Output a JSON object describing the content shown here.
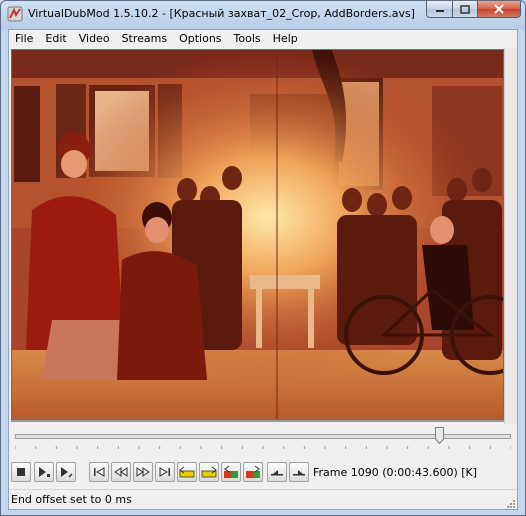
{
  "window": {
    "title": "VirtualDubMod 1.5.10.2 - [Красный захват_02_Crop, AddBorders.avs]"
  },
  "menu": [
    "File",
    "Edit",
    "Video",
    "Streams",
    "Options",
    "Tools",
    "Help"
  ],
  "toolbar": {
    "buttons": [
      "stop-icon",
      "play-input-icon",
      "play-output-icon",
      "go-start-icon",
      "back-icon",
      "forward-icon",
      "go-end-icon",
      "prev-keyframe-icon",
      "next-keyframe-icon",
      "prev-scene-icon",
      "next-scene-icon",
      "mark-in-icon",
      "mark-out-icon"
    ],
    "frame_info": "Frame 1090 (0:00:43.600) [K]"
  },
  "timeline": {
    "position": 0.855
  },
  "status": {
    "text": "End offset set to 0 ms"
  }
}
